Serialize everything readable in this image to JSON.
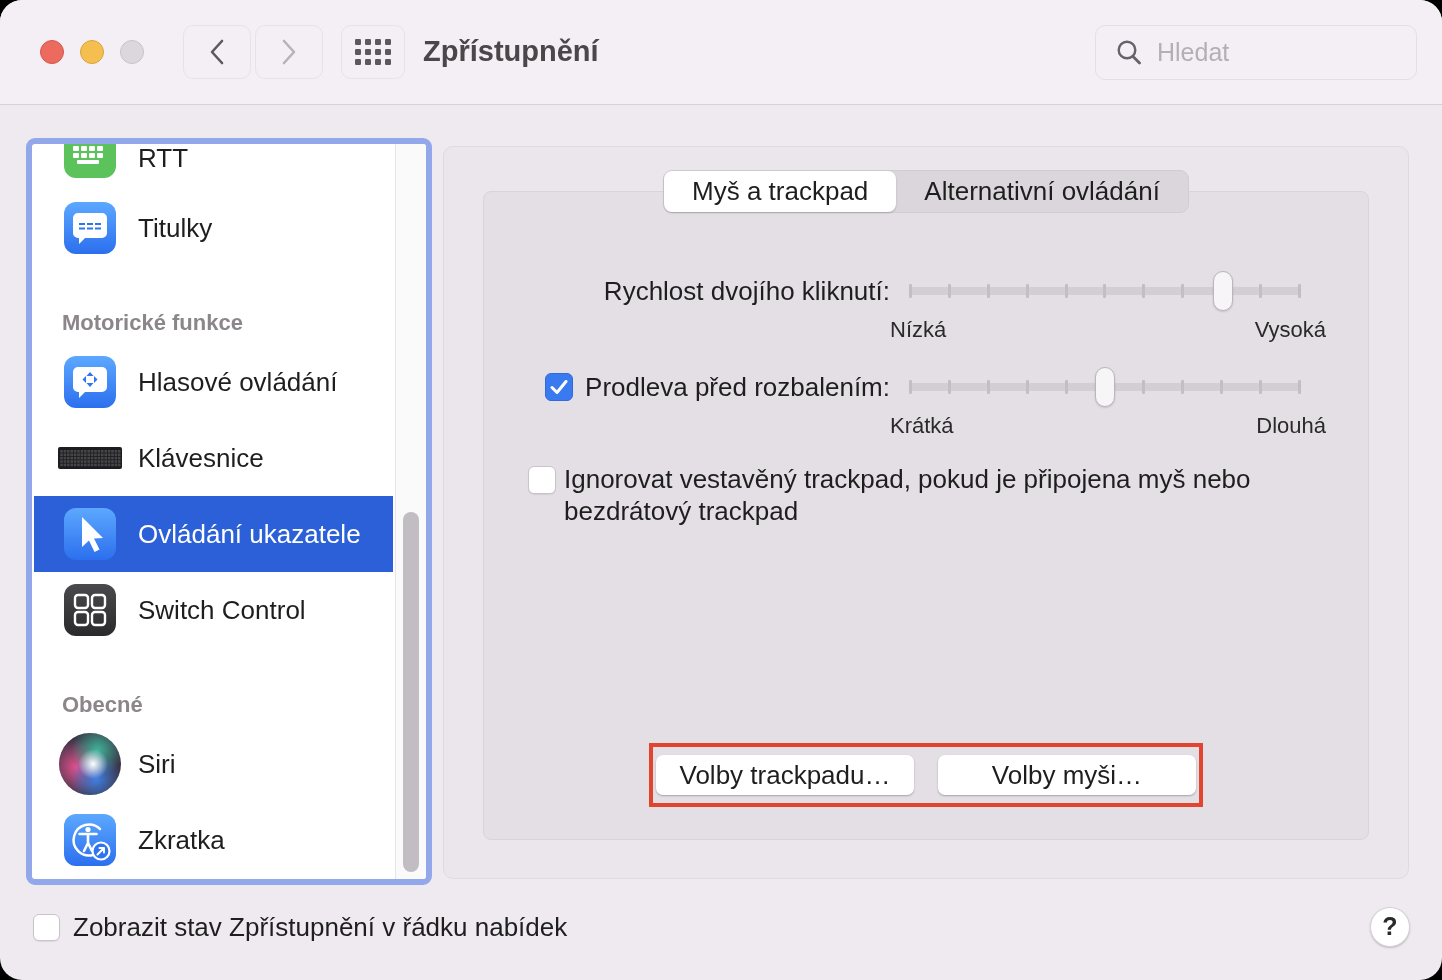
{
  "window": {
    "title": "Zpřístupnění"
  },
  "toolbar": {
    "nav": [
      {
        "kind": "back",
        "disabled": false
      },
      {
        "kind": "forward",
        "disabled": true
      }
    ],
    "search": {
      "placeholder": "Hledat"
    }
  },
  "sidebar": {
    "sections": [
      {
        "items": [
          {
            "label": "RTT",
            "selected": false
          },
          {
            "label": "Titulky",
            "selected": false
          }
        ]
      },
      {
        "header": "Motorické funkce",
        "items": [
          {
            "label": "Hlasové ovládání",
            "selected": false
          },
          {
            "label": "Klávesnice",
            "selected": false
          },
          {
            "label": "Ovládání ukazatele",
            "selected": true
          },
          {
            "label": "Switch Control",
            "selected": false
          }
        ]
      },
      {
        "header": "Obecné",
        "items": [
          {
            "label": "Siri",
            "selected": false
          },
          {
            "label": "Zkratka",
            "selected": false
          }
        ]
      }
    ]
  },
  "panel": {
    "tabs": [
      {
        "label": "Myš a trackpad",
        "selected": true
      },
      {
        "label": "Alternativní ovládání",
        "selected": false
      }
    ],
    "sliders": [
      {
        "kind": "slider",
        "label": "Rychlost dvojího kliknutí:",
        "level": 0.8,
        "min_label": "Nízká",
        "max_label": "Vysoká"
      },
      {
        "kind": "checkbox_slider",
        "label": "Prodleva před rozbalením:",
        "checked": true,
        "level": 0.5,
        "min_label": "Krátká",
        "max_label": "Dlouhá"
      }
    ],
    "option": {
      "label": "Ignorovat vestavěný trackpad, pokud je připojena myš nebo bezdrátový trackpad",
      "checked": false
    },
    "buttons": [
      {
        "label": "Volby trackpadu…"
      },
      {
        "label": "Volby myši…"
      }
    ],
    "buttons_highlighted": true
  },
  "footer": {
    "checkbox": {
      "label": "Zobrazit stav Zpřístupnění v řádku nabídek",
      "checked": false
    },
    "help_button": {
      "label": "?"
    }
  }
}
